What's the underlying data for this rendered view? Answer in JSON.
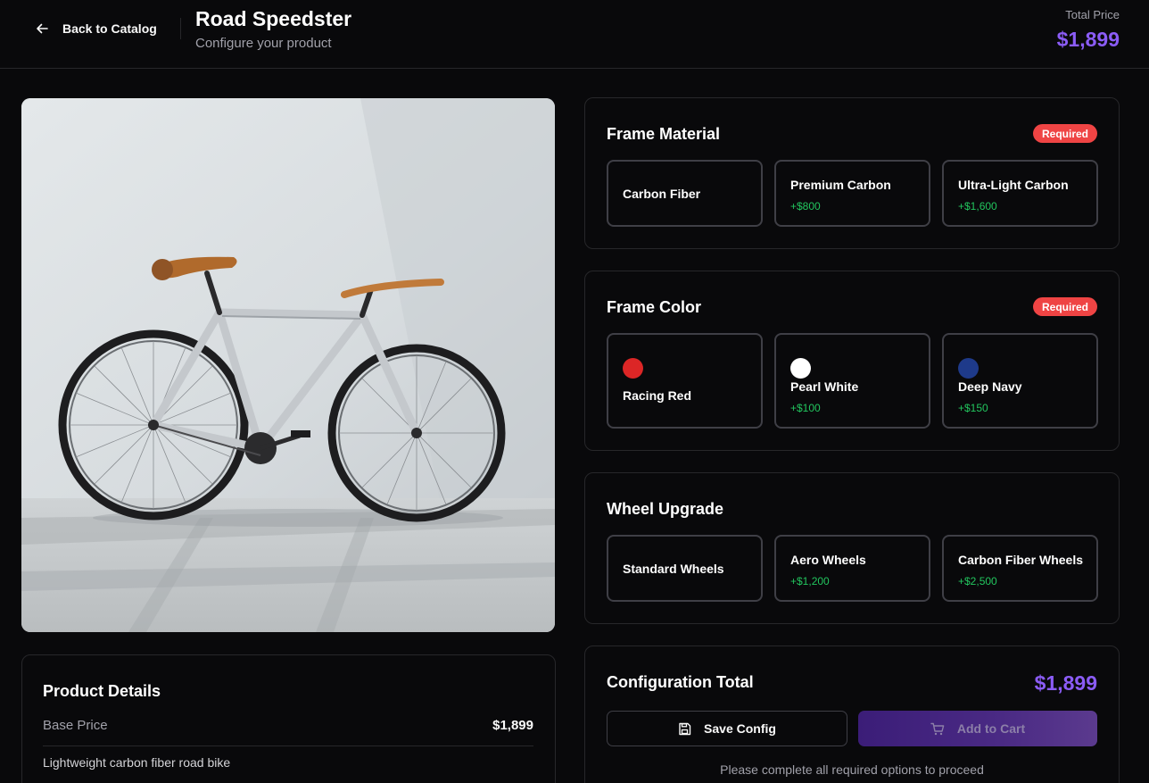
{
  "header": {
    "back_label": "Back to Catalog",
    "title": "Road Speedster",
    "subtitle": "Configure your product",
    "total_label": "Total Price",
    "total_value": "$1,899"
  },
  "details": {
    "title": "Product Details",
    "base_price_label": "Base Price",
    "base_price_value": "$1,899",
    "description": "Lightweight carbon fiber road bike"
  },
  "frame_material": {
    "title": "Frame Material",
    "badge": "Required",
    "options": [
      {
        "name": "Carbon Fiber",
        "price": ""
      },
      {
        "name": "Premium Carbon",
        "price": "+$800"
      },
      {
        "name": "Ultra-Light Carbon",
        "price": "+$1,600"
      }
    ]
  },
  "frame_color": {
    "title": "Frame Color",
    "badge": "Required",
    "options": [
      {
        "name": "Racing Red",
        "price": "",
        "swatch": "#dc2626"
      },
      {
        "name": "Pearl White",
        "price": "+$100",
        "swatch": "#ffffff"
      },
      {
        "name": "Deep Navy",
        "price": "+$150",
        "swatch": "#1e3a8a"
      }
    ]
  },
  "wheel_upgrade": {
    "title": "Wheel Upgrade",
    "options": [
      {
        "name": "Standard Wheels",
        "price": ""
      },
      {
        "name": "Aero Wheels",
        "price": "+$1,200"
      },
      {
        "name": "Carbon Fiber Wheels",
        "price": "+$2,500"
      }
    ]
  },
  "configuration": {
    "title": "Configuration Total",
    "total": "$1,899",
    "save_label": "Save Config",
    "cart_label": "Add to Cart",
    "hint": "Please complete all required options to proceed"
  },
  "colors": {
    "accent": "#8b5cf6",
    "required": "#ef4444",
    "price_green": "#22c55e",
    "background": "#09090b",
    "border": "#27272a"
  }
}
